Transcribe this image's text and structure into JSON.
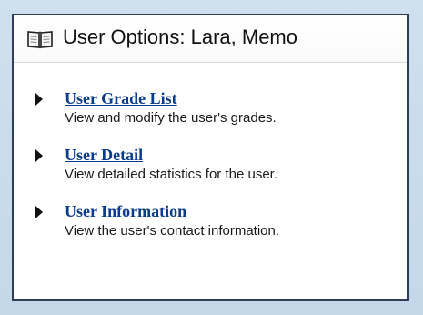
{
  "panel": {
    "title": "User Options: Lara, Memo",
    "title_icon": "open-book-icon"
  },
  "options": [
    {
      "label": "User Grade List",
      "description": "View and modify the user's grades."
    },
    {
      "label": "User Detail",
      "description": "View detailed statistics for the user."
    },
    {
      "label": "User Information",
      "description": "View the user's contact information."
    }
  ],
  "colors": {
    "link": "#0a3c8c",
    "border": "#2f3d58",
    "background": "#cfe0ee"
  }
}
